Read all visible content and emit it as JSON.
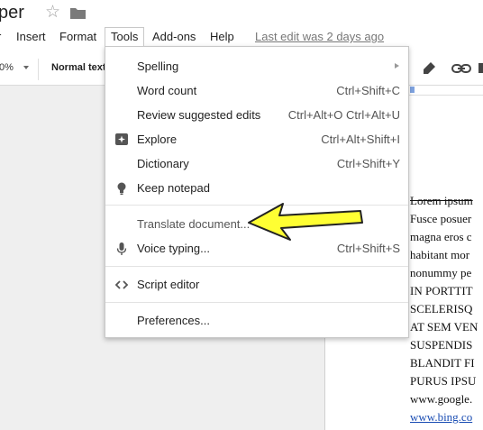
{
  "header": {
    "doc_title": "per",
    "star_icon": "star-outline-icon",
    "folder_icon": "folder-icon"
  },
  "menubar": {
    "items": [
      {
        "label": "Insert"
      },
      {
        "label": "Format"
      },
      {
        "label": "Tools"
      },
      {
        "label": "Add-ons"
      },
      {
        "label": "Help"
      }
    ],
    "last_edit": "Last edit was 2 days ago"
  },
  "toolbar": {
    "zoom": "0%",
    "style": "Normal text",
    "icons": [
      "highlighter-icon",
      "link-icon",
      "comment-icon"
    ]
  },
  "tools_menu": {
    "items": [
      {
        "label": "Spelling",
        "shortcut": "",
        "icon": "",
        "submenu": true
      },
      {
        "label": "Word count",
        "shortcut": "Ctrl+Shift+C",
        "icon": ""
      },
      {
        "label": "Review suggested edits",
        "shortcut": "Ctrl+Alt+O Ctrl+Alt+U",
        "icon": ""
      },
      {
        "label": "Explore",
        "shortcut": "Ctrl+Alt+Shift+I",
        "icon": "explore-icon"
      },
      {
        "label": "Dictionary",
        "shortcut": "Ctrl+Shift+Y",
        "icon": ""
      },
      {
        "label": "Keep notepad",
        "shortcut": "",
        "icon": "lightbulb-icon"
      },
      {
        "label": "Translate document...",
        "shortcut": "",
        "icon": ""
      },
      {
        "label": "Voice typing...",
        "shortcut": "Ctrl+Shift+S",
        "icon": "microphone-icon"
      },
      {
        "label": "Script editor",
        "shortcut": "",
        "icon": "code-icon"
      },
      {
        "label": "Preferences...",
        "shortcut": "",
        "icon": ""
      }
    ]
  },
  "document": {
    "lines": [
      "Lorem ipsum",
      "Fusce posuer",
      "magna eros c",
      "habitant mor",
      "nonummy pe",
      "IN PORTTIT",
      "SCELERISQ",
      "AT SEM VEN",
      "SUSPENDIS",
      "BLANDIT FI",
      "PURUS IPSU",
      "www.google.",
      "www.bing.co"
    ]
  },
  "annotation": {
    "arrow_color": "#ffff33",
    "arrow_outline": "#222222"
  },
  "colors": {
    "workspace": "#efefef",
    "menu_border": "#c8c8c8",
    "link": "#1a4db3"
  }
}
